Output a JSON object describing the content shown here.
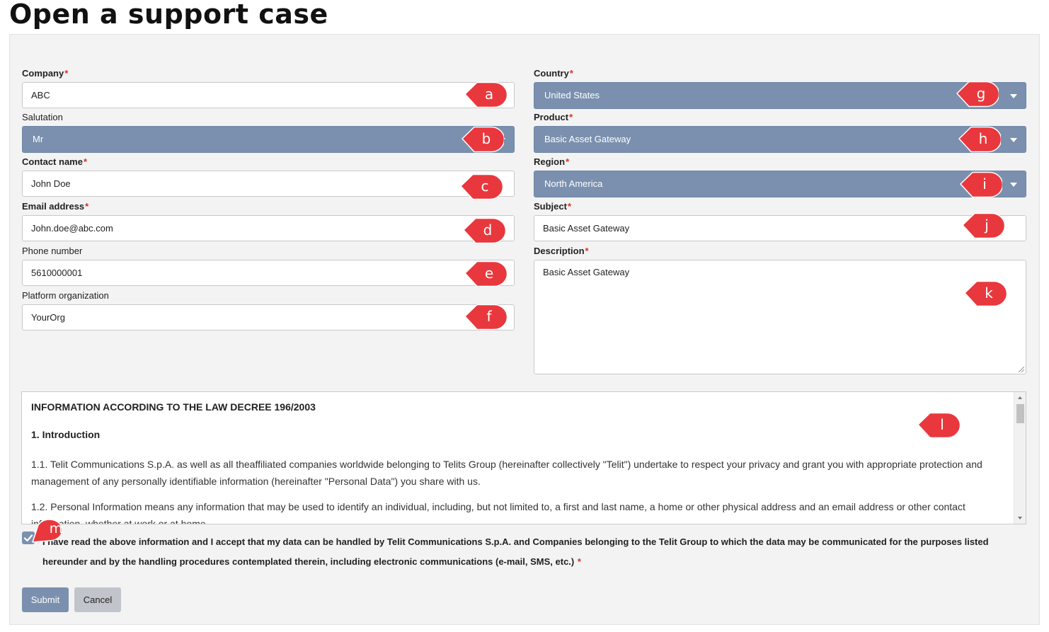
{
  "page": {
    "title": "Open a support case"
  },
  "form": {
    "company": {
      "label": "Company",
      "required_mark": "*",
      "value": "ABC"
    },
    "salutation": {
      "label": "Salutation",
      "value": "Mr"
    },
    "contact_name": {
      "label": "Contact name",
      "required_mark": "*",
      "value": "John Doe"
    },
    "email": {
      "label": "Email address",
      "required_mark": "*",
      "value": "John.doe@abc.com"
    },
    "phone": {
      "label": "Phone number",
      "value": "5610000001"
    },
    "platform_org": {
      "label": "Platform organization",
      "value": "YourOrg"
    },
    "country": {
      "label": "Country",
      "required_mark": "*",
      "value": "United States"
    },
    "product": {
      "label": "Product",
      "required_mark": "*",
      "value": "Basic Asset Gateway"
    },
    "region": {
      "label": "Region",
      "required_mark": "*",
      "value": "North America"
    },
    "subject": {
      "label": "Subject",
      "required_mark": "*",
      "value": "Basic Asset Gateway"
    },
    "description": {
      "label": "Description",
      "required_mark": "*",
      "value": "Basic Asset Gateway"
    }
  },
  "info": {
    "heading": "INFORMATION ACCORDING TO THE LAW DECREE 196/2003",
    "section_title": "1. Introduction",
    "para1": "1.1. Telit Communications S.p.A. as well as all theaffiliated companies worldwide belonging to Telits Group (hereinafter collectively \"Telit\") undertake to respect your privacy and grant you with appropriate protection and management of any personally identifiable information (hereinafter \"Personal Data\") you share with us.",
    "para2": "1.2. Personal Information means any information that may be used to identify an individual, including, but not limited to, a first and last name, a home or other physical address and an email address or other contact information, whether at work or at home."
  },
  "consent": {
    "checked": true,
    "text": "I have read the above information and I accept that my data can be handled by Telit Communications S.p.A. and Companies belonging to the Telit Group to which the data may be communicated for the purposes listed hereunder and by the handling procedures contemplated therein, including electronic communications (e-mail, SMS, etc.)",
    "required_mark": "*"
  },
  "buttons": {
    "submit": "Submit",
    "cancel": "Cancel"
  },
  "annotations": {
    "a": "a",
    "b": "b",
    "c": "c",
    "d": "d",
    "e": "e",
    "f": "f",
    "g": "g",
    "h": "h",
    "i": "i",
    "j": "j",
    "k": "k",
    "l": "l",
    "m": "m"
  },
  "colors": {
    "select_bg": "#7a90ae",
    "panel_bg": "#f3f3f3",
    "required": "#d93025",
    "callout": "#e8383d",
    "cancel_bg": "#c1c5cb"
  },
  "icons": {
    "dropdown": "caret-down-icon",
    "checkbox": "checkmark-icon",
    "annotation": "callout-marker-icon"
  }
}
